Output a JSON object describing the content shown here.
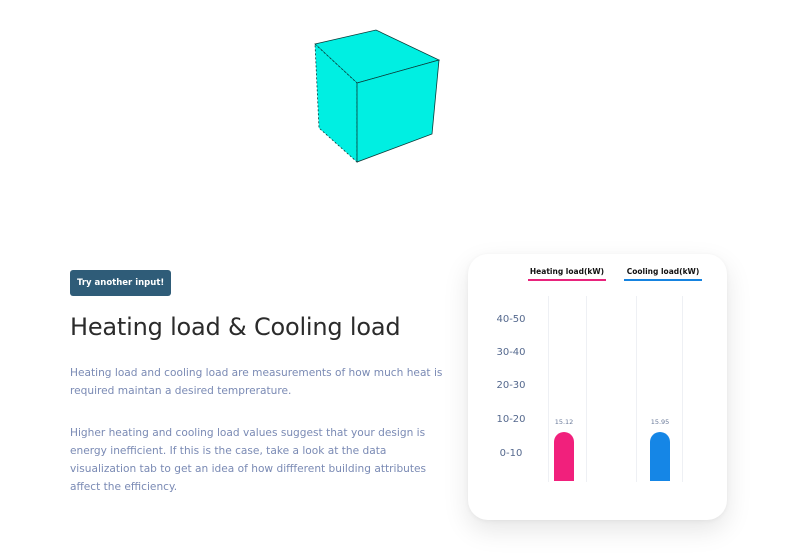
{
  "model_view": {
    "icon": "cube-icon",
    "cube_color": "#00efe2"
  },
  "action": {
    "button_label": "Try another input!",
    "button_color": "#2f5c78"
  },
  "content": {
    "title": "Heating load & Cooling load",
    "paragraph_1": "Heating load and cooling load are measurements of how much heat is required maintan a desired temprerature.",
    "paragraph_2": "Higher heating and cooling load values suggest that your design is energy inefficient. If this is the case, take a look at the data visualization tab to get an idea of how diffferent building attributes affect the efficiency."
  },
  "chart_data": {
    "type": "bar",
    "categories": [
      "Heating load(kW)",
      "Cooling load(kW)"
    ],
    "series": [
      {
        "name": "Heating load(kW)",
        "values": [
          15.12
        ],
        "color": "#f1207c"
      },
      {
        "name": "Cooling load(kW)",
        "values": [
          15.95
        ],
        "color": "#1586e6"
      }
    ],
    "values": [
      15.12,
      15.95
    ],
    "value_labels": [
      "15.12",
      "15.95"
    ],
    "y_ticks": [
      "40-50",
      "30-40",
      "20-30",
      "10-20",
      "0-10"
    ],
    "title": "",
    "xlabel": "",
    "ylabel": "",
    "legend_position": "top",
    "grid": true
  }
}
